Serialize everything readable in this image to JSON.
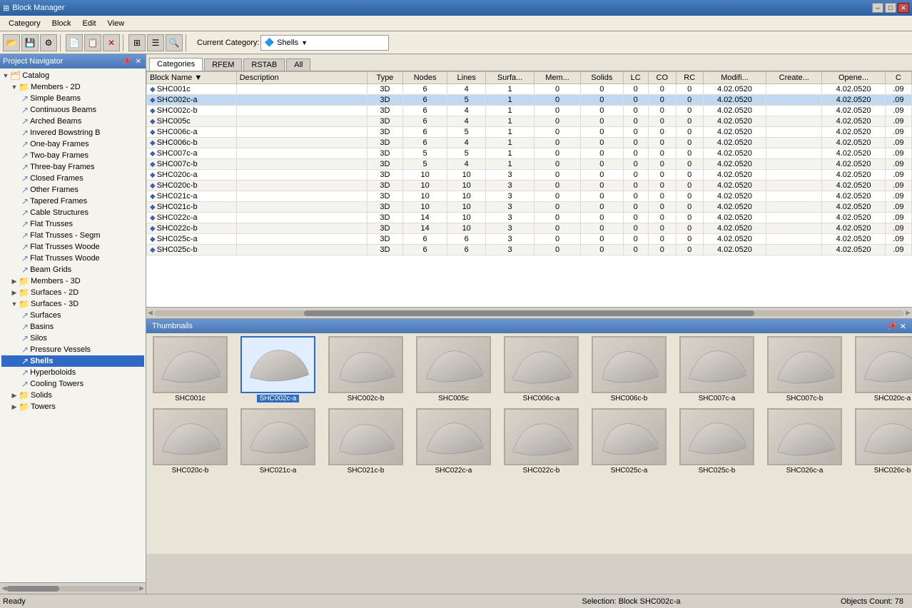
{
  "titleBar": {
    "appIcon": "⊞",
    "title": "Block Manager",
    "minimizeBtn": "–",
    "maximizeBtn": "□",
    "closeBtn": "✕"
  },
  "menuBar": {
    "items": [
      "Category",
      "Block",
      "Edit",
      "View"
    ]
  },
  "toolbar": {
    "currentCategoryLabel": "Current Category:",
    "currentCategory": "Shells",
    "categoryIcon": "🔷",
    "buttons": [
      "📂",
      "💾",
      "⚙",
      "📄",
      "📋",
      "❌",
      "🔲",
      "🔲",
      "⊞",
      "🔍"
    ]
  },
  "navigator": {
    "title": "Project Navigator",
    "pinBtn": "📌",
    "closeBtn": "✕",
    "tree": [
      {
        "id": "catalog",
        "label": "Catalog",
        "level": 0,
        "type": "root",
        "expanded": true
      },
      {
        "id": "members-2d",
        "label": "Members - 2D",
        "level": 1,
        "type": "folder",
        "expanded": true
      },
      {
        "id": "simple-beams",
        "label": "Simple Beams",
        "level": 2,
        "type": "leaf"
      },
      {
        "id": "continuous-beams",
        "label": "Continuous Beams",
        "level": 2,
        "type": "leaf"
      },
      {
        "id": "arched-beams",
        "label": "Arched Beams",
        "level": 2,
        "type": "leaf"
      },
      {
        "id": "invered-bowstring",
        "label": "Invered Bowstring B",
        "level": 2,
        "type": "leaf"
      },
      {
        "id": "one-bay-frames",
        "label": "One-bay Frames",
        "level": 2,
        "type": "leaf"
      },
      {
        "id": "two-bay-frames",
        "label": "Two-bay Frames",
        "level": 2,
        "type": "leaf"
      },
      {
        "id": "three-bay-frames",
        "label": "Three-bay Frames",
        "level": 2,
        "type": "leaf"
      },
      {
        "id": "closed-frames",
        "label": "Closed Frames",
        "level": 2,
        "type": "leaf"
      },
      {
        "id": "other-frames",
        "label": "Other Frames",
        "level": 2,
        "type": "leaf"
      },
      {
        "id": "tapered-frames",
        "label": "Tapered Frames",
        "level": 2,
        "type": "leaf"
      },
      {
        "id": "cable-structures",
        "label": "Cable Structures",
        "level": 2,
        "type": "leaf"
      },
      {
        "id": "flat-trusses",
        "label": "Flat Trusses",
        "level": 2,
        "type": "leaf"
      },
      {
        "id": "flat-trusses-segm",
        "label": "Flat Trusses - Segm",
        "level": 2,
        "type": "leaf"
      },
      {
        "id": "flat-trusses-woode",
        "label": "Flat Trusses Woode",
        "level": 2,
        "type": "leaf"
      },
      {
        "id": "flat-trusses-woode2",
        "label": "Flat Trusses Woode",
        "level": 2,
        "type": "leaf"
      },
      {
        "id": "beam-grids",
        "label": "Beam Grids",
        "level": 2,
        "type": "leaf"
      },
      {
        "id": "members-3d",
        "label": "Members - 3D",
        "level": 1,
        "type": "folder",
        "expanded": false
      },
      {
        "id": "surfaces-2d",
        "label": "Surfaces - 2D",
        "level": 1,
        "type": "folder",
        "expanded": false
      },
      {
        "id": "surfaces-3d",
        "label": "Surfaces - 3D",
        "level": 1,
        "type": "folder",
        "expanded": true
      },
      {
        "id": "surfaces",
        "label": "Surfaces",
        "level": 2,
        "type": "leaf"
      },
      {
        "id": "basins",
        "label": "Basins",
        "level": 2,
        "type": "leaf"
      },
      {
        "id": "silos",
        "label": "Silos",
        "level": 2,
        "type": "leaf"
      },
      {
        "id": "pressure-vessels",
        "label": "Pressure Vessels",
        "level": 2,
        "type": "leaf"
      },
      {
        "id": "shells",
        "label": "Shells",
        "level": 2,
        "type": "leaf",
        "selected": true
      },
      {
        "id": "hyperboloids",
        "label": "Hyperboloids",
        "level": 2,
        "type": "leaf"
      },
      {
        "id": "cooling-towers",
        "label": "Cooling Towers",
        "level": 2,
        "type": "leaf"
      },
      {
        "id": "solids",
        "label": "Solids",
        "level": 1,
        "type": "folder",
        "expanded": false
      },
      {
        "id": "towers",
        "label": "Towers",
        "level": 1,
        "type": "folder",
        "expanded": false
      }
    ]
  },
  "tabs": {
    "items": [
      "Categories",
      "RFEM",
      "RSTAB",
      "All"
    ],
    "active": 0
  },
  "table": {
    "columns": [
      "Block Name",
      "Description",
      "Type",
      "Nodes",
      "Lines",
      "Surfa...",
      "Mem...",
      "Solids",
      "LC",
      "CO",
      "RC",
      "Modifi...",
      "Create...",
      "Opene...",
      "C"
    ],
    "rows": [
      {
        "name": "SHC001c",
        "desc": "",
        "type": "3D",
        "nodes": 6,
        "lines": 4,
        "surfaces": 1,
        "mem": 0,
        "solids": 0,
        "lc": 0,
        "co": 0,
        "rc": 0,
        "modifi": "4.02.0520",
        "create": "",
        "opene": "4.02.0520",
        "c": ".09"
      },
      {
        "name": "SHC002c-a",
        "desc": "",
        "type": "3D",
        "nodes": 6,
        "lines": 5,
        "surfaces": 1,
        "mem": 0,
        "solids": 0,
        "lc": 0,
        "co": 0,
        "rc": 0,
        "modifi": "4.02.0520",
        "create": "",
        "opene": "4.02.0520",
        "c": ".09",
        "selected": true
      },
      {
        "name": "SHC002c-b",
        "desc": "",
        "type": "3D",
        "nodes": 6,
        "lines": 4,
        "surfaces": 1,
        "mem": 0,
        "solids": 0,
        "lc": 0,
        "co": 0,
        "rc": 0,
        "modifi": "4.02.0520",
        "create": "",
        "opene": "4.02.0520",
        "c": ".09"
      },
      {
        "name": "SHC005c",
        "desc": "",
        "type": "3D",
        "nodes": 6,
        "lines": 4,
        "surfaces": 1,
        "mem": 0,
        "solids": 0,
        "lc": 0,
        "co": 0,
        "rc": 0,
        "modifi": "4.02.0520",
        "create": "",
        "opene": "4.02.0520",
        "c": ".09"
      },
      {
        "name": "SHC006c-a",
        "desc": "",
        "type": "3D",
        "nodes": 6,
        "lines": 5,
        "surfaces": 1,
        "mem": 0,
        "solids": 0,
        "lc": 0,
        "co": 0,
        "rc": 0,
        "modifi": "4.02.0520",
        "create": "",
        "opene": "4.02.0520",
        "c": ".09"
      },
      {
        "name": "SHC006c-b",
        "desc": "",
        "type": "3D",
        "nodes": 6,
        "lines": 4,
        "surfaces": 1,
        "mem": 0,
        "solids": 0,
        "lc": 0,
        "co": 0,
        "rc": 0,
        "modifi": "4.02.0520",
        "create": "",
        "opene": "4.02.0520",
        "c": ".09"
      },
      {
        "name": "SHC007c-a",
        "desc": "",
        "type": "3D",
        "nodes": 5,
        "lines": 5,
        "surfaces": 1,
        "mem": 0,
        "solids": 0,
        "lc": 0,
        "co": 0,
        "rc": 0,
        "modifi": "4.02.0520",
        "create": "",
        "opene": "4.02.0520",
        "c": ".09"
      },
      {
        "name": "SHC007c-b",
        "desc": "",
        "type": "3D",
        "nodes": 5,
        "lines": 4,
        "surfaces": 1,
        "mem": 0,
        "solids": 0,
        "lc": 0,
        "co": 0,
        "rc": 0,
        "modifi": "4.02.0520",
        "create": "",
        "opene": "4.02.0520",
        "c": ".09"
      },
      {
        "name": "SHC020c-a",
        "desc": "",
        "type": "3D",
        "nodes": 10,
        "lines": 10,
        "surfaces": 3,
        "mem": 0,
        "solids": 0,
        "lc": 0,
        "co": 0,
        "rc": 0,
        "modifi": "4.02.0520",
        "create": "",
        "opene": "4.02.0520",
        "c": ".09"
      },
      {
        "name": "SHC020c-b",
        "desc": "",
        "type": "3D",
        "nodes": 10,
        "lines": 10,
        "surfaces": 3,
        "mem": 0,
        "solids": 0,
        "lc": 0,
        "co": 0,
        "rc": 0,
        "modifi": "4.02.0520",
        "create": "",
        "opene": "4.02.0520",
        "c": ".09"
      },
      {
        "name": "SHC021c-a",
        "desc": "",
        "type": "3D",
        "nodes": 10,
        "lines": 10,
        "surfaces": 3,
        "mem": 0,
        "solids": 0,
        "lc": 0,
        "co": 0,
        "rc": 0,
        "modifi": "4.02.0520",
        "create": "",
        "opene": "4.02.0520",
        "c": ".09"
      },
      {
        "name": "SHC021c-b",
        "desc": "",
        "type": "3D",
        "nodes": 10,
        "lines": 10,
        "surfaces": 3,
        "mem": 0,
        "solids": 0,
        "lc": 0,
        "co": 0,
        "rc": 0,
        "modifi": "4.02.0520",
        "create": "",
        "opene": "4.02.0520",
        "c": ".09"
      },
      {
        "name": "SHC022c-a",
        "desc": "",
        "type": "3D",
        "nodes": 14,
        "lines": 10,
        "surfaces": 3,
        "mem": 0,
        "solids": 0,
        "lc": 0,
        "co": 0,
        "rc": 0,
        "modifi": "4.02.0520",
        "create": "",
        "opene": "4.02.0520",
        "c": ".09"
      },
      {
        "name": "SHC022c-b",
        "desc": "",
        "type": "3D",
        "nodes": 14,
        "lines": 10,
        "surfaces": 3,
        "mem": 0,
        "solids": 0,
        "lc": 0,
        "co": 0,
        "rc": 0,
        "modifi": "4.02.0520",
        "create": "",
        "opene": "4.02.0520",
        "c": ".09"
      },
      {
        "name": "SHC025c-a",
        "desc": "",
        "type": "3D",
        "nodes": 6,
        "lines": 6,
        "surfaces": 3,
        "mem": 0,
        "solids": 0,
        "lc": 0,
        "co": 0,
        "rc": 0,
        "modifi": "4.02.0520",
        "create": "",
        "opene": "4.02.0520",
        "c": ".09"
      },
      {
        "name": "SHC025c-b",
        "desc": "",
        "type": "3D",
        "nodes": 6,
        "lines": 6,
        "surfaces": 3,
        "mem": 0,
        "solids": 0,
        "lc": 0,
        "co": 0,
        "rc": 0,
        "modifi": "4.02.0520",
        "create": "",
        "opene": "4.02.0520",
        "c": ".09"
      }
    ]
  },
  "thumbnails": {
    "title": "Thumbnails",
    "row1": [
      {
        "id": "SHC001c",
        "label": "SHC001c",
        "selected": false
      },
      {
        "id": "SHC002c-a",
        "label": "SHC002c-a",
        "selected": true
      },
      {
        "id": "SHC002c-b",
        "label": "SHC002c-b",
        "selected": false
      },
      {
        "id": "SHC005c",
        "label": "SHC005c",
        "selected": false
      },
      {
        "id": "SHC006c-a",
        "label": "SHC006c-a",
        "selected": false
      },
      {
        "id": "SHC006c-b",
        "label": "SHC006c-b",
        "selected": false
      },
      {
        "id": "SHC007c-a",
        "label": "SHC007c-a",
        "selected": false
      },
      {
        "id": "SHC007c-b",
        "label": "SHC007c-b",
        "selected": false
      },
      {
        "id": "SHC020c-a",
        "label": "SHC020c-a",
        "selected": false
      }
    ],
    "row2": [
      {
        "id": "SHC020c-b",
        "label": "SHC020c-b",
        "selected": false
      },
      {
        "id": "SHC021c-a",
        "label": "SHC021c-a",
        "selected": false
      },
      {
        "id": "SHC021c-b",
        "label": "SHC021c-b",
        "selected": false
      },
      {
        "id": "SHC022c-a",
        "label": "SHC022c-a",
        "selected": false
      },
      {
        "id": "SHC022c-b",
        "label": "SHC022c-b",
        "selected": false
      },
      {
        "id": "SHC025c-a",
        "label": "SHC025c-a",
        "selected": false
      },
      {
        "id": "SHC025c-b",
        "label": "SHC025c-b",
        "selected": false
      },
      {
        "id": "SHC026c-a",
        "label": "SHC026c-a",
        "selected": false
      },
      {
        "id": "SHC026c-b",
        "label": "SHC026c-b",
        "selected": false
      }
    ]
  },
  "statusBar": {
    "left": "Ready",
    "mid": "",
    "right": "Selection: Block SHC002c-a",
    "objectCount": "Objects Count: 78"
  }
}
